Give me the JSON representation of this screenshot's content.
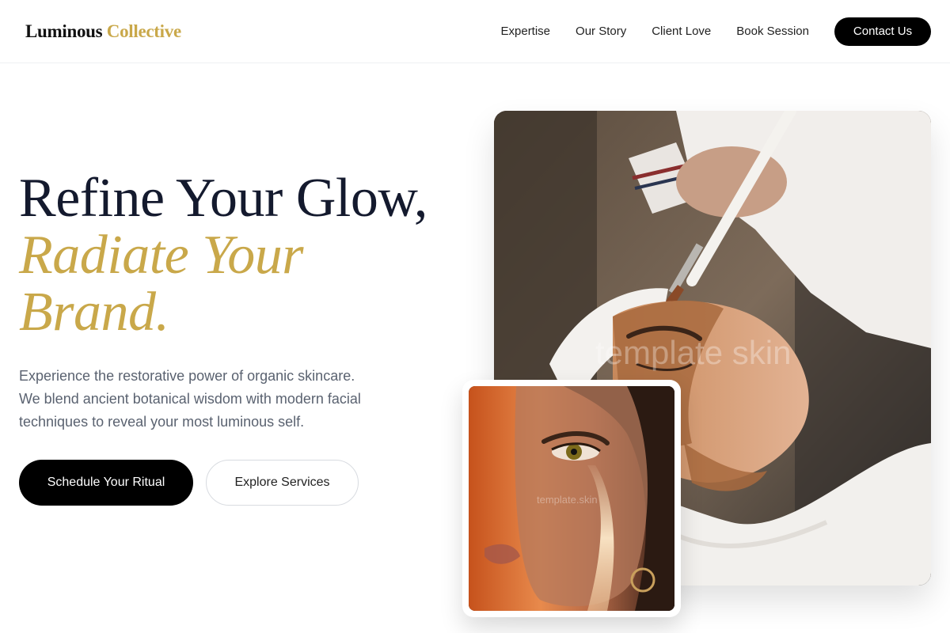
{
  "brand": {
    "first": "Luminous",
    "second": "Collective"
  },
  "nav": {
    "links": [
      "Expertise",
      "Our Story",
      "Client Love",
      "Book Session"
    ],
    "contact_label": "Contact Us"
  },
  "hero": {
    "line1": "Refine Your Glow,",
    "line2": "Radiate Your",
    "line3": "Brand.",
    "description": "Experience the restorative power of organic skincare. We blend ancient botanical wisdom with modern facial techniques to reveal your most luminous self.",
    "primary_cta": "Schedule Your Ritual",
    "secondary_cta": "Explore Services"
  },
  "images": {
    "main_watermark": "template skin",
    "small_watermark": "template.skin"
  },
  "colors": {
    "accent": "#c9a84a",
    "dark": "#141a2e",
    "button": "#000000"
  }
}
